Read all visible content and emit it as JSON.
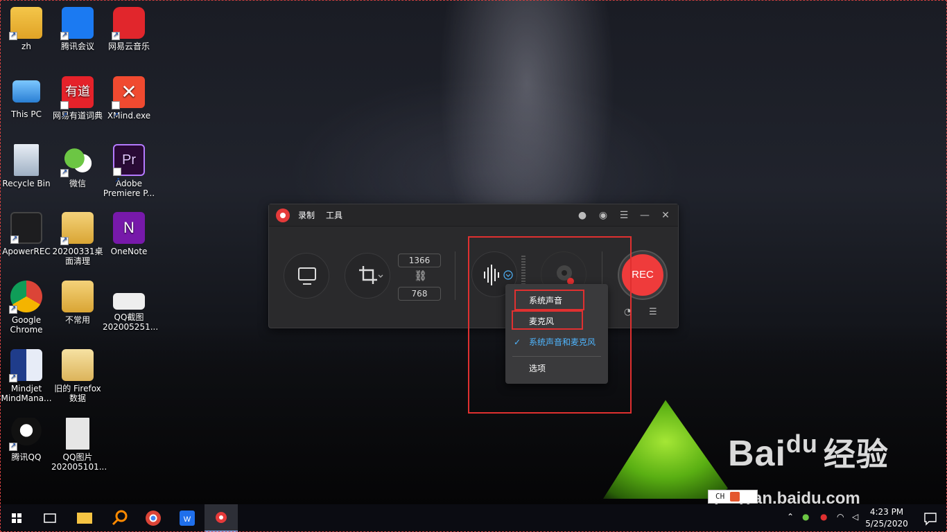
{
  "desktop_icons": [
    {
      "label": "zh"
    },
    {
      "label": "腾讯会议"
    },
    {
      "label": "网易云音乐"
    },
    {
      "label": "This PC"
    },
    {
      "label": "网易有道词典"
    },
    {
      "label": "XMind.exe"
    },
    {
      "label": "Recycle Bin"
    },
    {
      "label": "微信"
    },
    {
      "label": "Adobe Premiere P..."
    },
    {
      "label": "ApowerREC"
    },
    {
      "label": "20200331桌面清理"
    },
    {
      "label": "OneNote"
    },
    {
      "label": "Google Chrome"
    },
    {
      "label": "不常用"
    },
    {
      "label": "QQ截图202005251..."
    },
    {
      "label": "Mindjet MindMana..."
    },
    {
      "label": "旧的 Firefox 数据"
    },
    {
      "label": "腾讯QQ"
    },
    {
      "label": "QQ图片202005101..."
    }
  ],
  "recorder": {
    "menu": [
      "录制",
      "工具"
    ],
    "width": "1366",
    "height": "768",
    "rec_label": "REC"
  },
  "audio_menu": {
    "items": [
      "系统声音",
      "麦克风",
      "系统声音和麦克风",
      "选项"
    ],
    "checked": "系统声音和麦克风"
  },
  "taskbar": {
    "ime": "CH",
    "time": "4:23 PM",
    "date": "5/25/2020"
  },
  "watermark": {
    "brand": "Bai",
    "brand2": "du",
    "cn": "经验",
    "url": "jingyan.baidu.com"
  },
  "colors": {
    "rec_red": "#ef3b3b",
    "highlight_box": "#e03030",
    "check_blue": "#4fb6ff"
  }
}
